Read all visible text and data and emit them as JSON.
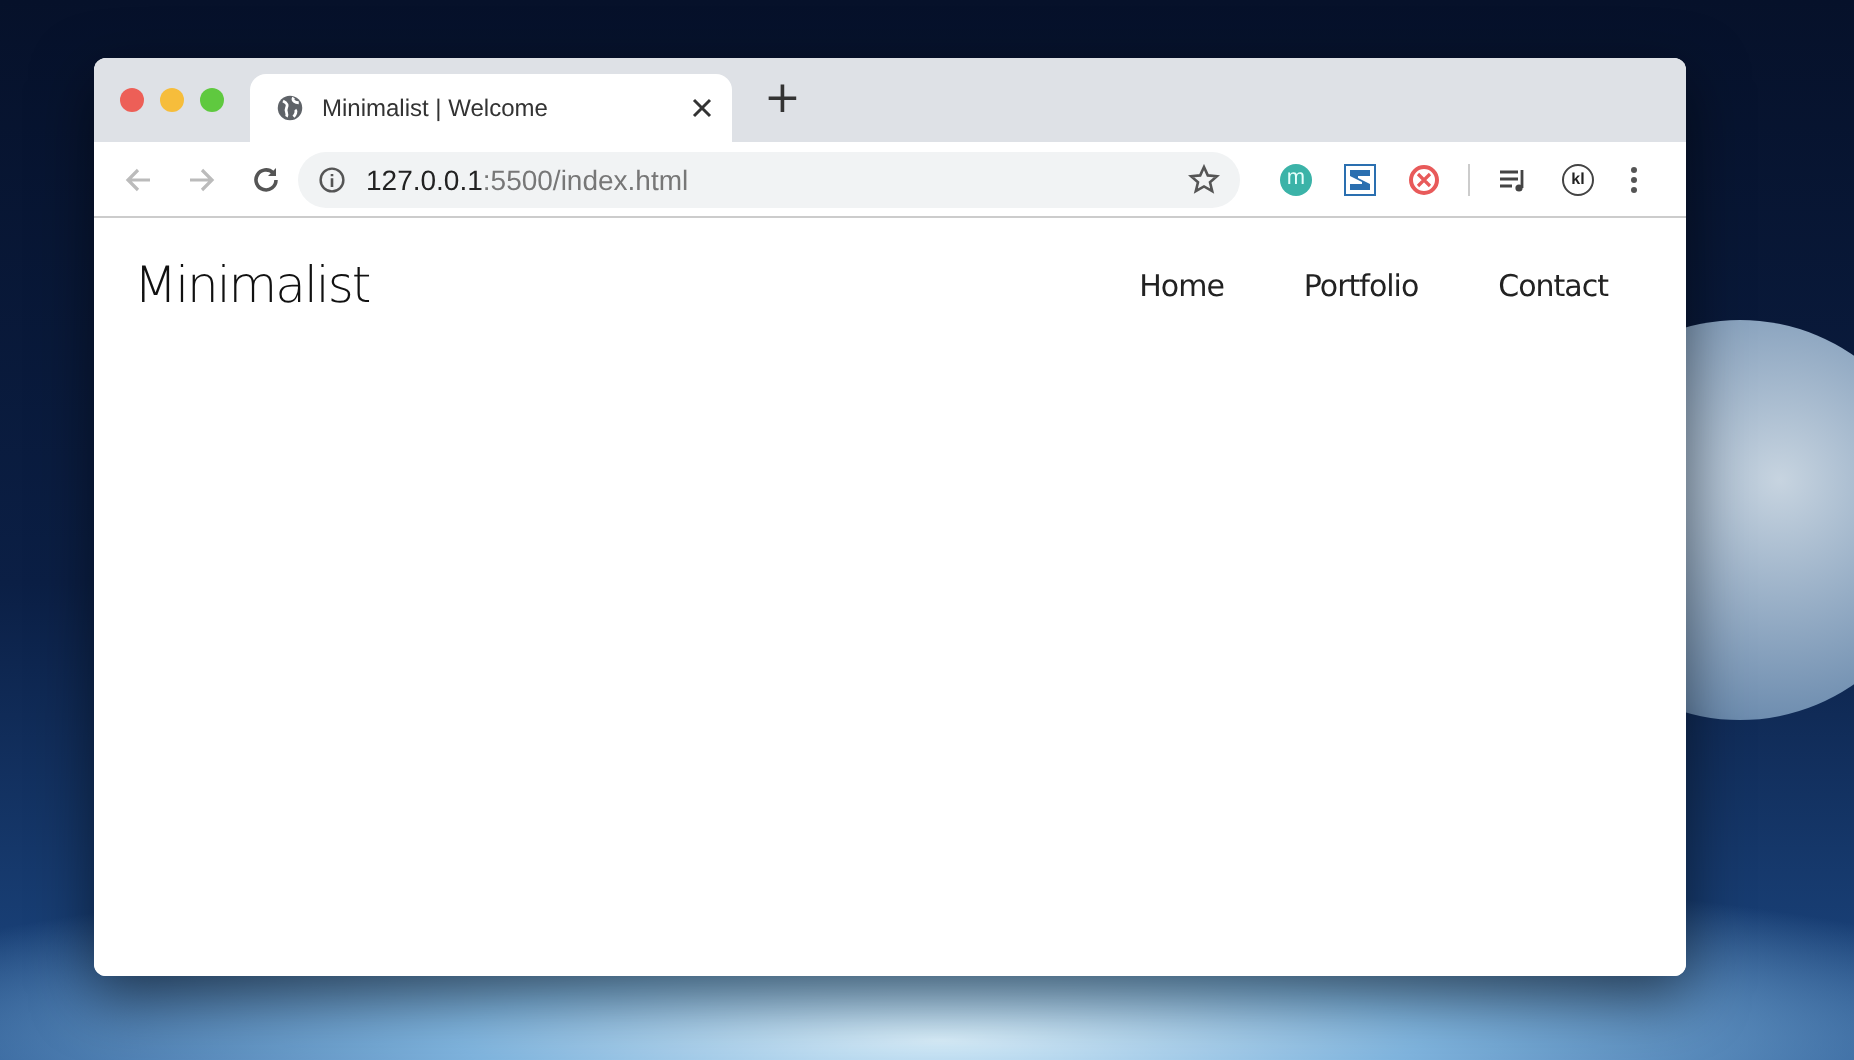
{
  "window": {
    "tab": {
      "title": "Minimalist | Welcome",
      "selected": true
    },
    "new_tab": "+",
    "address": "**127.0.0.1**:5500/index.html",
    "extensions": [
      {
        "kind": "letter",
        "text": "m"
      },
      {
        "kind": "logo"
      },
      {
        "kind": "ring"
      },
      {
        "kind": "divider"
      },
      {
        "kind": "playlist"
      },
      {
        "kind": "circle",
        "text": "kl"
      }
    ]
  },
  "page": {
    "logo": "Minimalist",
    "nav": [
      "Home",
      "Portfolio",
      "Contact"
    ]
  }
}
